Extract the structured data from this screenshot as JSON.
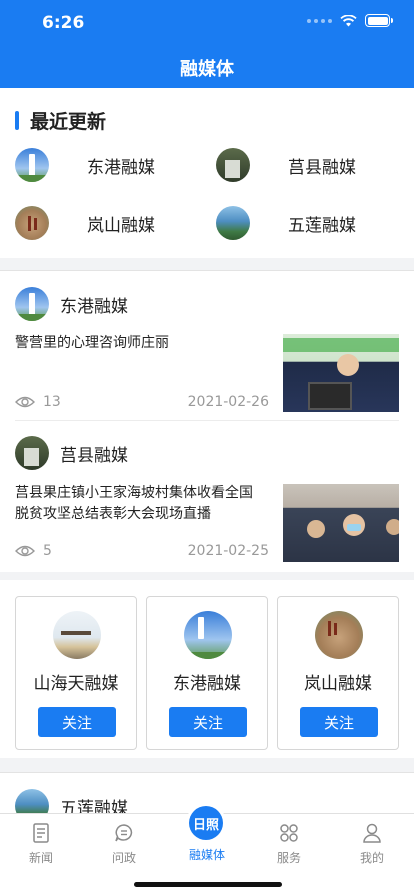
{
  "status": {
    "time": "6:26"
  },
  "header": {
    "title": "融媒体"
  },
  "recent": {
    "heading": "最近更新",
    "items": [
      {
        "label": "东港融媒"
      },
      {
        "label": "莒县融媒"
      },
      {
        "label": "岚山融媒"
      },
      {
        "label": "五莲融媒"
      }
    ]
  },
  "news": [
    {
      "source": "东港融媒",
      "title": "警营里的心理咨询师庄丽",
      "views": "13",
      "date": "2021-02-26"
    },
    {
      "source": "莒县融媒",
      "title": "莒县果庄镇小王家海坡村集体收看全国脱贫攻坚总结表彰大会现场直播",
      "views": "5",
      "date": "2021-02-25"
    }
  ],
  "follow": {
    "cards": [
      {
        "name": "山海天融媒",
        "button": "关注"
      },
      {
        "name": "东港融媒",
        "button": "关注"
      },
      {
        "name": "岚山融媒",
        "button": "关注"
      }
    ]
  },
  "next_card": {
    "source": "五莲融媒"
  },
  "tabbar": {
    "badge": "日照",
    "items": [
      {
        "label": "新闻"
      },
      {
        "label": "问政"
      },
      {
        "label": "融媒体"
      },
      {
        "label": "服务"
      },
      {
        "label": "我的"
      }
    ]
  },
  "colors": {
    "accent": "#1a7cf2",
    "muted": "#999999"
  }
}
